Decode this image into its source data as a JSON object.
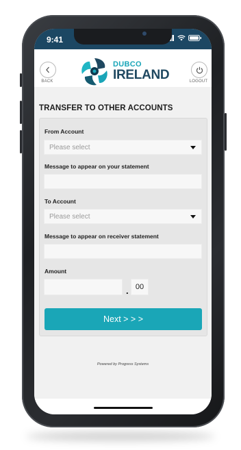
{
  "status_bar": {
    "time": "9:41"
  },
  "header": {
    "back_label": "BACK",
    "logout_label": "LOGOUT",
    "logo_top": "DUBCO",
    "logo_bottom": "IRELAND"
  },
  "page": {
    "title": "TRANSFER TO OTHER ACCOUNTS"
  },
  "form": {
    "from_account_label": "From Account",
    "from_account_value": "Please select",
    "statement_message_label": "Message to appear on your statement",
    "statement_message_value": "",
    "to_account_label": "To Account",
    "to_account_value": "Please select",
    "receiver_message_label": "Message to appear on receiver statement",
    "receiver_message_value": "",
    "amount_label": "Amount",
    "amount_whole_value": "",
    "amount_separator": ".",
    "amount_cents_value": "00",
    "next_label": "Next > > >"
  },
  "footer": {
    "powered_by": "Powered by Progress Systems"
  },
  "colors": {
    "accent": "#1aa6b7",
    "statusbar": "#1c4763",
    "brand_dark": "#1f4860"
  }
}
